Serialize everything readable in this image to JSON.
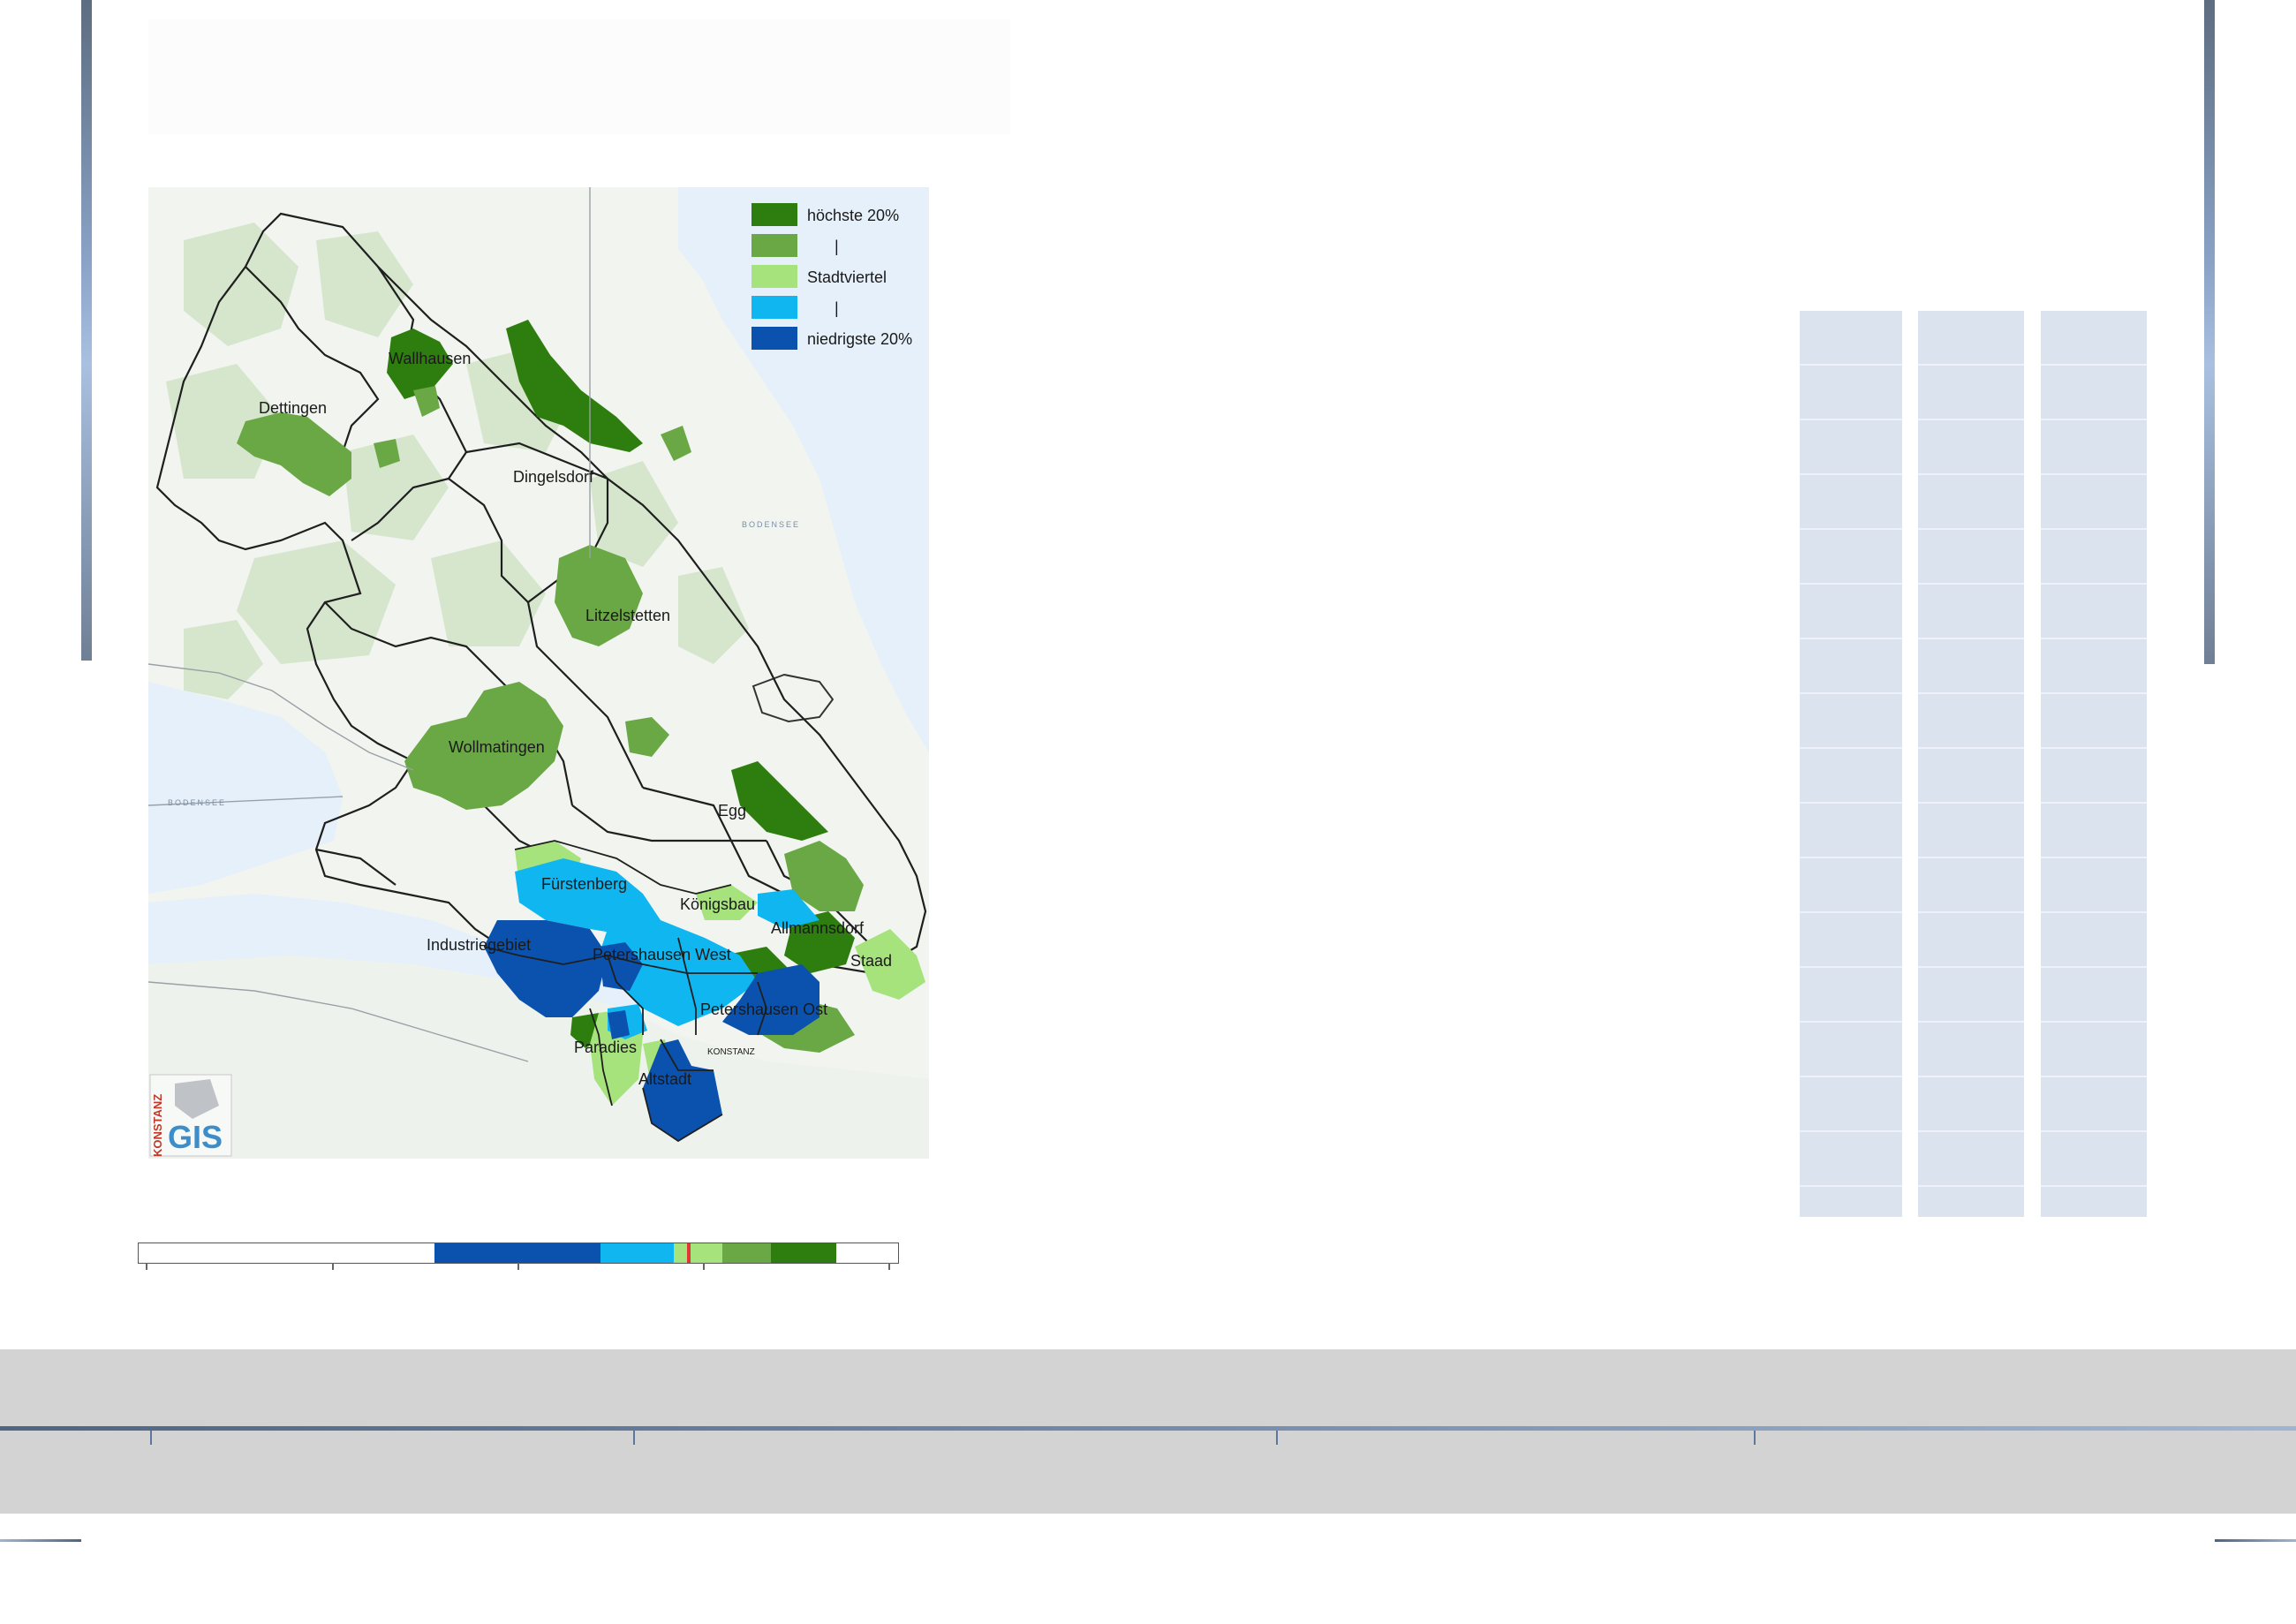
{
  "colors": {
    "highest": "#2e7d0f",
    "high": "#6aa845",
    "middle": "#a7e37d",
    "low": "#0fb6ef",
    "lowest": "#0a52ae",
    "lake": "#e6f0fb",
    "land": "#f2f5f0",
    "forest": "#d7e6cf",
    "table_fill": "#dbe3ef",
    "footer_band": "#d3d3d3",
    "scale_marker": "#e23636"
  },
  "map": {
    "legend": [
      {
        "class": "highest",
        "label": "höchste 20%"
      },
      {
        "class": "high",
        "label": "|"
      },
      {
        "class": "middle",
        "label": "Stadtviertel"
      },
      {
        "class": "low",
        "label": "|"
      },
      {
        "class": "lowest",
        "label": "niedrigste 20%"
      }
    ],
    "districts": {
      "wallhausen": {
        "label": "Wallhausen",
        "class": "highest"
      },
      "dettingen": {
        "label": "Dettingen",
        "class": "high"
      },
      "dingelsdorf": {
        "label": "Dingelsdorf",
        "class": "none"
      },
      "litzelstetten": {
        "label": "Litzelstetten",
        "class": "high"
      },
      "wollmatingen": {
        "label": "Wollmatingen",
        "class": "high"
      },
      "egg": {
        "label": "Egg",
        "class": "none"
      },
      "fuerstenberg": {
        "label": "Fürstenberg",
        "class": "low"
      },
      "koenigsbau": {
        "label": "Königsbau",
        "class": "low"
      },
      "allmannsdorf": {
        "label": "Allmannsdorf",
        "class": "highest"
      },
      "staad": {
        "label": "Staad",
        "class": "middle"
      },
      "industriegebiet": {
        "label": "Industriegebiet",
        "class": "lowest"
      },
      "petershausen_west": {
        "label": "Petershausen West",
        "class": "low"
      },
      "petershausen_ost": {
        "label": "Petershausen Ost",
        "class": "lowest"
      },
      "paradies": {
        "label": "Paradies",
        "class": "middle"
      },
      "altstadt": {
        "label": "Altstadt",
        "class": "lowest"
      }
    },
    "lake_labels": [
      "BODENSEE",
      "BODENSEE"
    ],
    "city_label": "KONSTANZ",
    "logo": {
      "text": "GIS",
      "vertical_text": "KONSTANZ"
    }
  },
  "scale_bar": {
    "segments": [
      {
        "class": "none"
      },
      {
        "class": "lowest"
      },
      {
        "class": "low"
      },
      {
        "class": "middle"
      },
      {
        "class": "high"
      },
      {
        "class": "highest"
      },
      {
        "class": "none"
      }
    ]
  }
}
